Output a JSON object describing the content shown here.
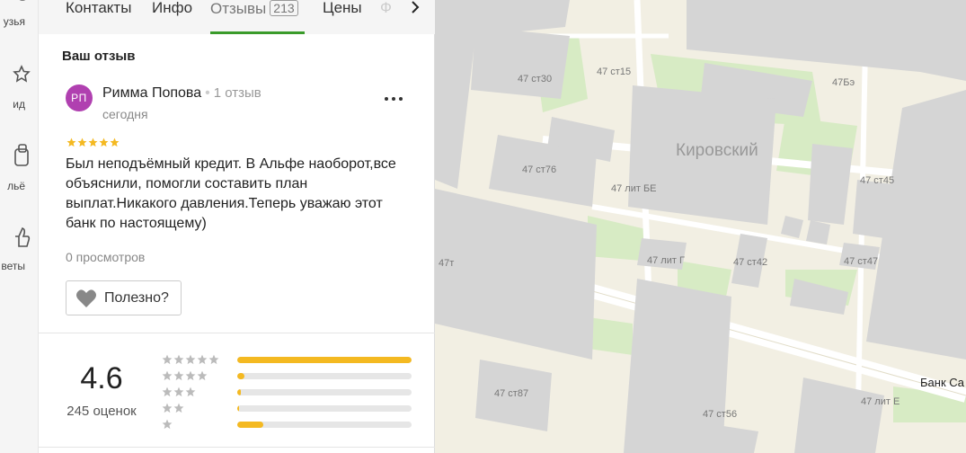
{
  "rail": {
    "items": [
      {
        "label": "узья",
        "icon": "friends-icon"
      },
      {
        "label": "ид",
        "icon": "guide-icon"
      },
      {
        "label": "льё",
        "icon": "photo-icon"
      },
      {
        "label": "веты",
        "icon": "like-icon"
      }
    ]
  },
  "tabs": [
    {
      "label": "Контакты"
    },
    {
      "label": "Инфо"
    },
    {
      "label": "Отзывы",
      "count": "213"
    },
    {
      "label": "Цены"
    },
    {
      "label": "Ф"
    }
  ],
  "review": {
    "section_title": "Ваш отзыв",
    "avatar_initials": "РП",
    "author": "Римма Попова",
    "author_reviews": "1 отзыв",
    "date": "сегодня",
    "stars": 5,
    "text": "Был неподъёмный кредит. В Альфе наоборот,все объяснили, помогли составить план выплат.Никакого давления.Теперь уважаю этот банк по настоящему)",
    "views": "0 просмотров",
    "useful_label": "Полезно?"
  },
  "rating": {
    "value": "4.6",
    "count": "245 оценок",
    "distribution": [
      {
        "stars": 5,
        "fraction": 1.0
      },
      {
        "stars": 4,
        "fraction": 0.04
      },
      {
        "stars": 3,
        "fraction": 0.02
      },
      {
        "stars": 2,
        "fraction": 0.01
      },
      {
        "stars": 1,
        "fraction": 0.15
      }
    ]
  },
  "map": {
    "district": "Кировский",
    "poi": "Банк Са",
    "labels": [
      "47 ст30",
      "47 ст15",
      "47Бэ",
      "47 ст76",
      "47 лит БЕ",
      "47 ст45",
      "47т",
      "47 лит Г",
      "47 ст42",
      "47 ст47",
      "47 ст87",
      "47 ст56",
      "47 лит Е"
    ]
  },
  "colors": {
    "accent_green": "#3a9b2a",
    "star_yellow": "#f4b921",
    "avatar_purple": "#b040b0"
  }
}
